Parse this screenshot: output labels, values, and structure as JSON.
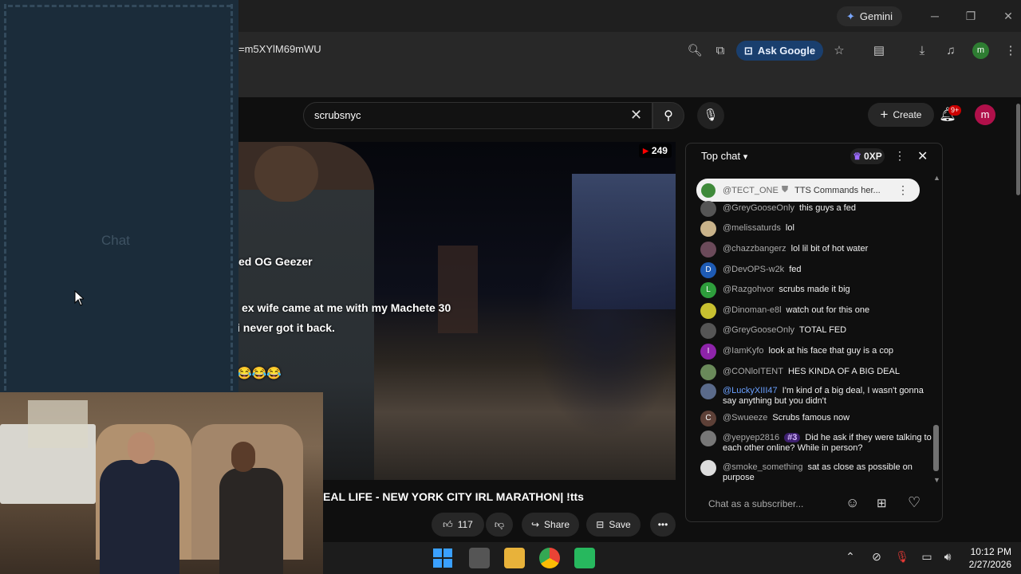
{
  "browser": {
    "gemini_label": "Gemini",
    "url_fragment": "=m5XYlM69mWU",
    "ask_google_label": "Ask Google",
    "profile_initial": "m"
  },
  "youtube": {
    "search_value": "scrubsnyc",
    "create_label": "Create",
    "notification_count": "9+",
    "avatar_initial": "m"
  },
  "video": {
    "viewer_count": "249",
    "overlay_lines": [
      "ed OG Geezer",
      "ex wife came at me with my Machete 30",
      "i never got it back.",
      "😂😂😂"
    ],
    "title": "EAL LIFE - NEW YORK CITY IRL MARATHON| !tts",
    "like_count": "117",
    "share_label": "Share",
    "save_label": "Save"
  },
  "chat": {
    "title": "Top chat",
    "xp_label": "0XP",
    "pinned_author": "@TECT_ONE",
    "pinned_text": "TTS Commands her...",
    "input_placeholder": "Chat as a subscriber...",
    "messages": [
      {
        "author": "@GreyGooseOnly",
        "text": "this guys a fed",
        "avatar_color": "#555",
        "avatar_initial": ""
      },
      {
        "author": "@melissaturds",
        "text": "lol",
        "avatar_color": "#c9b38a",
        "avatar_initial": ""
      },
      {
        "author": "@chazzbangerz",
        "text": "lol lil bit of hot water",
        "avatar_color": "#6b4a5a",
        "avatar_initial": ""
      },
      {
        "author": "@DevOPS-w2k",
        "text": "fed",
        "avatar_color": "#1e5bb5",
        "avatar_initial": "D"
      },
      {
        "author": "@Razgohvor",
        "text": "scrubs made it big",
        "avatar_color": "#2e9e3c",
        "avatar_initial": "L"
      },
      {
        "author": "@Dinoman-e8l",
        "text": "watch out for this one",
        "avatar_color": "#c8c030",
        "avatar_initial": ""
      },
      {
        "author": "@GreyGooseOnly",
        "text": "TOTAL FED",
        "avatar_color": "#555",
        "avatar_initial": ""
      },
      {
        "author": "@IamKyfo",
        "text": "look at his face that guy is a cop",
        "avatar_color": "#8e24aa",
        "avatar_initial": "I"
      },
      {
        "author": "@CONloITENT",
        "text": "HES KINDA OF A BIG DEAL",
        "avatar_color": "#6a8a5a",
        "avatar_initial": ""
      },
      {
        "author": "@LuckyXIII47",
        "text": "I'm kind of a big deal, I wasn't gonna say anything but you didn't",
        "avatar_color": "#5a6a8a",
        "avatar_initial": ""
      },
      {
        "author": "@Swueeze",
        "text": "Scrubs famous now",
        "avatar_color": "#5d4037",
        "avatar_initial": "C"
      },
      {
        "author": "@yepyep2816",
        "badge": "#3",
        "text": "Did he ask if they were talking to each other online? While in person?",
        "avatar_color": "#777",
        "avatar_initial": ""
      },
      {
        "author": "@smoke_something",
        "text": "sat as close as possible on purpose",
        "avatar_color": "#ddd",
        "avatar_initial": ""
      }
    ]
  },
  "overlay": {
    "label": "Chat"
  },
  "taskbar": {
    "time": "10:12 PM",
    "date": "2/27/2026"
  }
}
